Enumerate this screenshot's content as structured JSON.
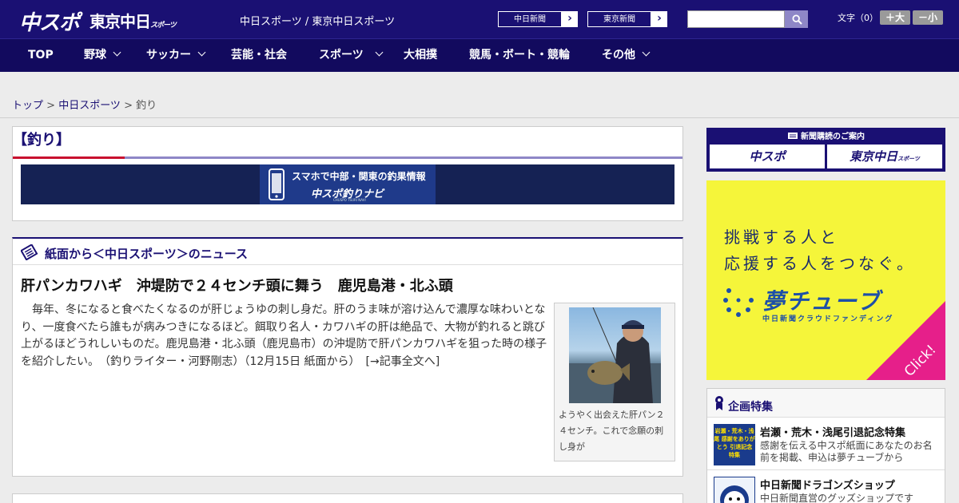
{
  "header": {
    "logo_main": "中スポ",
    "logo_sub": "東京中日",
    "logo_sub_small": "スポーツ",
    "site_links": "中日スポーツ / 東京中日スポーツ",
    "paper_buttons": [
      {
        "label": "中日新聞",
        "arrow": "›"
      },
      {
        "label": "東京新聞",
        "arrow": "›"
      }
    ],
    "search_placeholder": "",
    "font_label": "文字（0）",
    "font_large": "＋大",
    "font_small": "－小"
  },
  "nav": {
    "items": [
      {
        "label": "TOP",
        "dropdown": false
      },
      {
        "label": "野球",
        "dropdown": true
      },
      {
        "label": "サッカー",
        "dropdown": true
      },
      {
        "label": "芸能・社会",
        "dropdown": false
      },
      {
        "label": "スポーツ",
        "dropdown": true
      },
      {
        "label": "大相撲",
        "dropdown": false
      },
      {
        "label": "競馬・ボート・競輪",
        "dropdown": false
      },
      {
        "label": "その他",
        "dropdown": true
      }
    ]
  },
  "breadcrumb": {
    "home": "トップ",
    "sep": " > ",
    "section": "中日スポーツ",
    "current": "釣り"
  },
  "category": {
    "title": "【釣り】",
    "app_banner_line1": "スマホで中部・関東の釣果情報",
    "app_banner_line2": "中スポ釣りナビ",
    "app_banner_line3": "CHUSPO TSURI NAVI"
  },
  "news": {
    "heading": "紙面から＜中日スポーツ＞のニュース",
    "article_title": "肝パンカワハギ　沖堤防で２４センチ頭に舞う　鹿児島港・北ふ頭",
    "article_body": "毎年、冬になると食べたくなるのが肝じょうゆの刺し身だ。肝のうま味が溶け込んで濃厚な味わいとなり、一度食べたら誰もが病みつきになるほど。餌取り名人・カワハギの肝は絶品で、大物が釣れると跳び上がるほどうれしいものだ。鹿児島港・北ふ頭（鹿児島市）の沖堤防で肝パンカワハギを狙った時の様子を紹介したい。　（釣りライター・河野剛志）（12月15日 紙面から）　[→記事全文へ]",
    "photo_caption": "ようやく出会えた肝パン２４センチ。これで念願の刺し身が"
  },
  "sidebar": {
    "subscribe_title": "新聞購読のご案内",
    "subscribe_buttons": [
      "中スポ",
      "東京中日"
    ],
    "subscribe_small": "スポーツ",
    "yume_line1": "挑戦する人と",
    "yume_line2": "応援する人をつなぐ。",
    "yume_brand": "夢チューブ",
    "yume_brand_sub": "中日新聞クラウドファンディング",
    "yume_click": "Click!",
    "features_heading": "企画特集",
    "features": [
      {
        "thumb": "岩瀬・荒木・浅尾 感謝をありがとう 引退記念 特集",
        "title": "岩瀬・荒木・浅尾引退記念特集",
        "desc": "感謝を伝える中スポ紙面にあなたのお名前を掲載、申込は夢チューブから"
      },
      {
        "thumb": "",
        "title": "中日新聞ドラゴンズショップ",
        "desc": "中日新聞直営のグッズショップです"
      }
    ]
  },
  "colors": {
    "brand_navy": "#1a1073",
    "accent_red": "#c8102e",
    "yume_yellow": "#f5f53a",
    "click_pink": "#e61f8a"
  }
}
